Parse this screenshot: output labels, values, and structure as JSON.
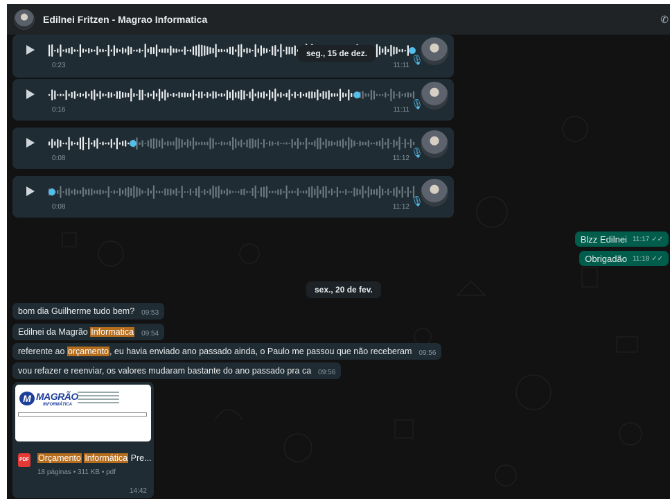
{
  "header": {
    "contact_name": "Edilnei Fritzen - Magrao Informatica",
    "call_icon": "phone-icon"
  },
  "voice_messages": [
    {
      "duration": "0:23",
      "time": "11:11",
      "progress": 1.0
    },
    {
      "duration": "0:16",
      "time": "11:11",
      "progress": 0.84
    },
    {
      "duration": "0:08",
      "time": "11:12",
      "progress": 0.23
    },
    {
      "duration": "0:08",
      "time": "11:12",
      "progress": 0.0
    }
  ],
  "date_pills": {
    "first": "seg., 15 de dez.",
    "second": "sex., 20 de fev."
  },
  "outgoing": [
    {
      "text": "Blzz Edilnei",
      "time": "11:17"
    },
    {
      "text": "Obrigadão",
      "time": "11:18"
    }
  ],
  "incoming": [
    {
      "pre": "bom dia Guilherme tudo bem?",
      "hl": "",
      "post": "",
      "time": "09:53"
    },
    {
      "pre": "Edilnei da Magrão ",
      "hl": "Informatica",
      "post": "",
      "time": "09:54"
    },
    {
      "pre": "referente ao ",
      "hl": "orçamento",
      "post": ", eu havia enviado ano passado ainda, o Paulo me passou que não receberam",
      "time": "09:56"
    },
    {
      "pre": "vou refazer e reenviar, os valores mudaram bastante do ano passado pra ca",
      "hl": "",
      "post": "",
      "time": "09:56"
    }
  ],
  "document": {
    "preview_logo": "MAGRÃO",
    "preview_subtitle": "INFORMÁTICA",
    "file_badge": "PDF",
    "name_hl1": "Orçamento",
    "name_hl2": "Informática",
    "name_rest": " Pre...",
    "meta": "18 páginas • 311 KB • pdf",
    "time": "14:42"
  },
  "colors": {
    "outgoing_bubble": "#005c4b",
    "incoming_bubble": "#202c33",
    "accent": "#53bdeb",
    "highlight": "#b56d1e"
  }
}
